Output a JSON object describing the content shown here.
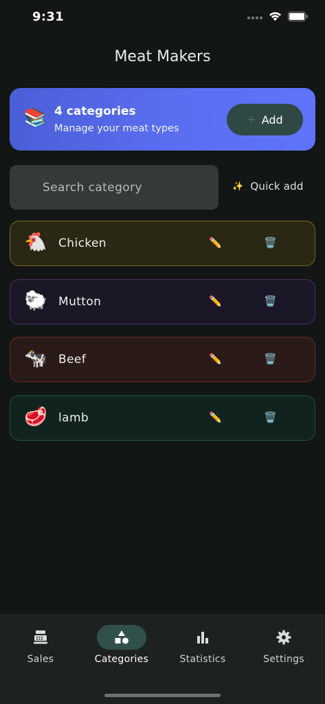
{
  "status_bar": {
    "time": "9:31"
  },
  "header": {
    "title": "Meat Makers"
  },
  "banner": {
    "icon": "📚",
    "title": "4 categories",
    "subtitle": "Manage your meat types",
    "add_plus": "+",
    "add_label": "Add"
  },
  "search": {
    "placeholder": "Search category",
    "value": ""
  },
  "quick_add": {
    "icon": "✨",
    "label": "Quick add"
  },
  "categories": [
    {
      "emoji": "🐔",
      "name": "Chicken"
    },
    {
      "emoji": "🐑",
      "name": "Mutton"
    },
    {
      "emoji": "🐄",
      "name": "Beef"
    },
    {
      "emoji": "🥩",
      "name": "lamb"
    }
  ],
  "row_icons": {
    "edit": "✏️",
    "delete": "🗑️"
  },
  "nav": {
    "items": [
      {
        "label": "Sales",
        "icon": "cash-register-icon",
        "active": false
      },
      {
        "label": "Categories",
        "icon": "shapes-icon",
        "active": true
      },
      {
        "label": "Statistics",
        "icon": "bar-chart-icon",
        "active": false
      },
      {
        "label": "Settings",
        "icon": "gear-icon",
        "active": false
      }
    ]
  },
  "colors": {
    "background": "#121615",
    "banner_start": "#4a5fd6",
    "banner_end": "#5f74fb",
    "add_button": "#2f4843",
    "nav_active_pill": "#31504a"
  }
}
